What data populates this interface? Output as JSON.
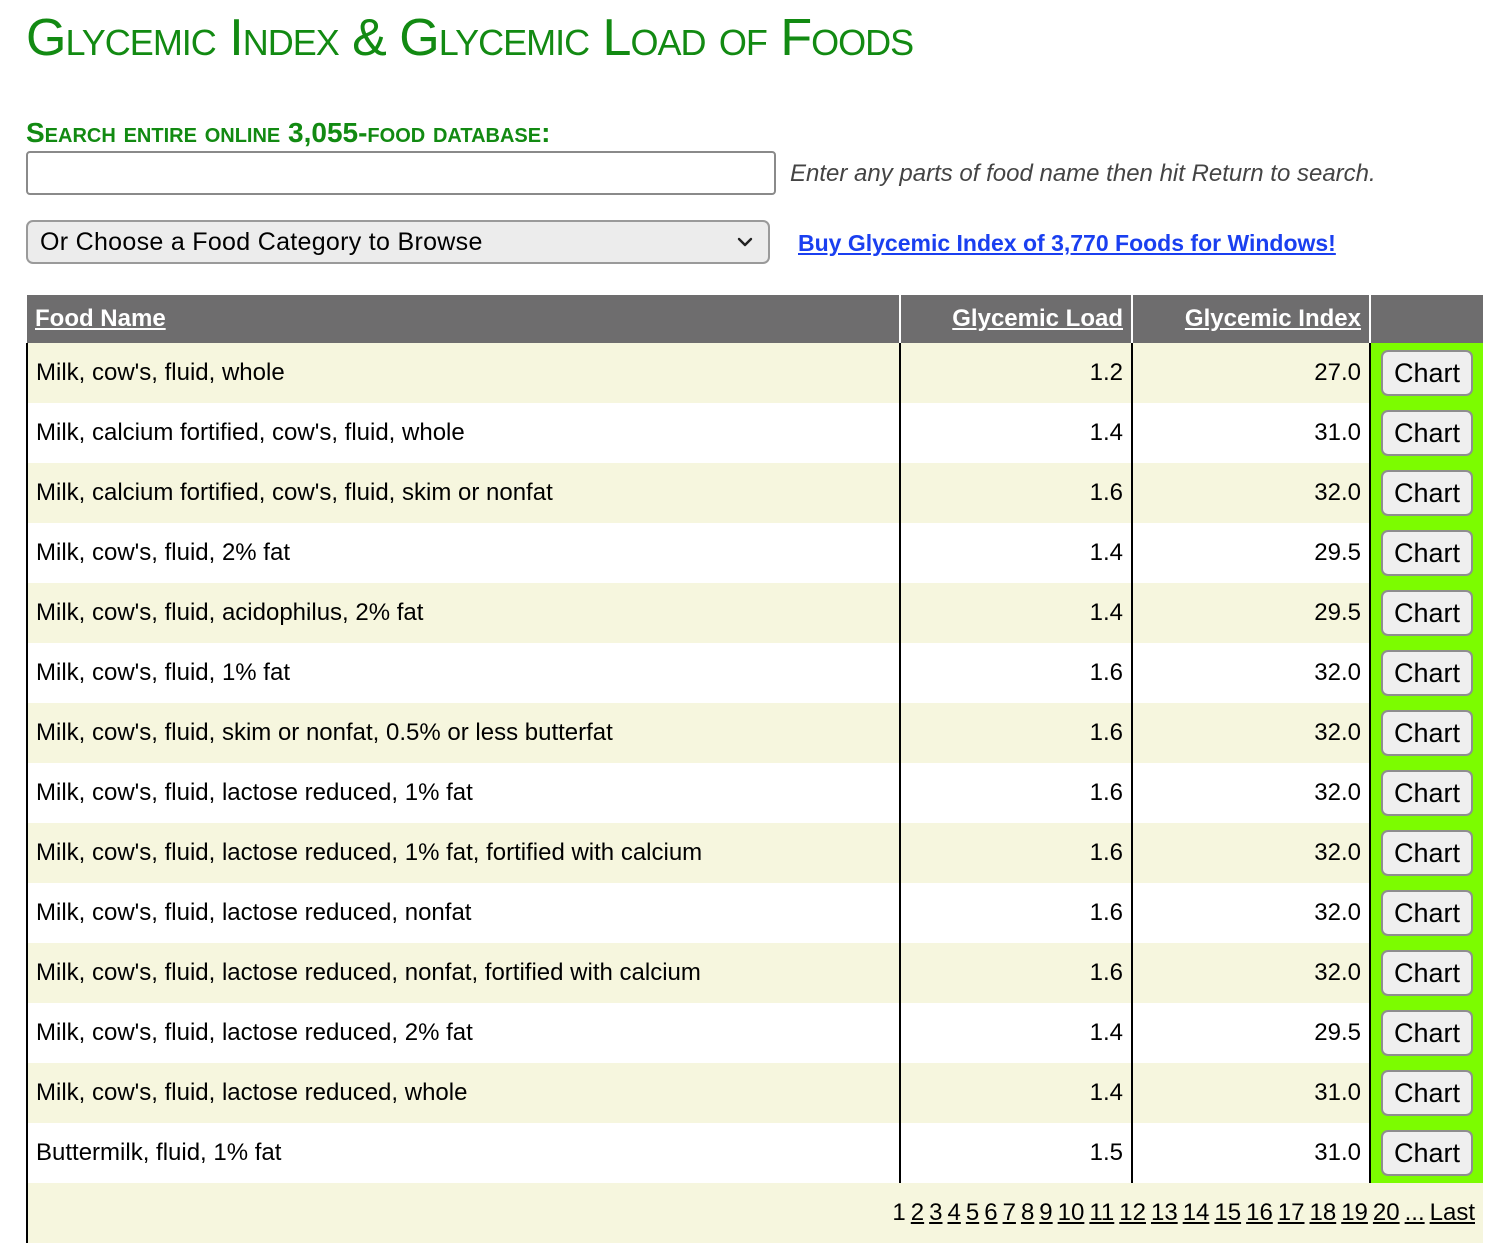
{
  "title": "Glycemic Index & Glycemic Load of Foods",
  "search": {
    "label": "Search entire online 3,055-food database:",
    "value": "",
    "placeholder": "",
    "hint": "Enter any parts of food name then hit Return to search."
  },
  "category": {
    "selected": "Or Choose a Food Category to Browse"
  },
  "buy_link": "Buy Glycemic Index of 3,770 Foods for Windows!",
  "table": {
    "headers": {
      "name": "Food Name",
      "load": "Glycemic Load",
      "index": "Glycemic Index"
    },
    "chart_label": "Chart",
    "rows": [
      {
        "name": "Milk, cow's, fluid, whole",
        "load": "1.2",
        "index": "27.0"
      },
      {
        "name": "Milk, calcium fortified, cow's, fluid, whole",
        "load": "1.4",
        "index": "31.0"
      },
      {
        "name": "Milk, calcium fortified, cow's, fluid, skim or nonfat",
        "load": "1.6",
        "index": "32.0"
      },
      {
        "name": "Milk, cow's, fluid, 2% fat",
        "load": "1.4",
        "index": "29.5"
      },
      {
        "name": "Milk, cow's, fluid, acidophilus, 2% fat",
        "load": "1.4",
        "index": "29.5"
      },
      {
        "name": "Milk, cow's, fluid, 1% fat",
        "load": "1.6",
        "index": "32.0"
      },
      {
        "name": "Milk, cow's, fluid, skim or nonfat, 0.5% or less butterfat",
        "load": "1.6",
        "index": "32.0"
      },
      {
        "name": "Milk, cow's, fluid, lactose reduced, 1% fat",
        "load": "1.6",
        "index": "32.0"
      },
      {
        "name": "Milk, cow's, fluid, lactose reduced, 1% fat, fortified with calcium",
        "load": "1.6",
        "index": "32.0"
      },
      {
        "name": "Milk, cow's, fluid, lactose reduced, nonfat",
        "load": "1.6",
        "index": "32.0"
      },
      {
        "name": "Milk, cow's, fluid, lactose reduced, nonfat, fortified with calcium",
        "load": "1.6",
        "index": "32.0"
      },
      {
        "name": "Milk, cow's, fluid, lactose reduced, 2% fat",
        "load": "1.4",
        "index": "29.5"
      },
      {
        "name": "Milk, cow's, fluid, lactose reduced, whole",
        "load": "1.4",
        "index": "31.0"
      },
      {
        "name": "Buttermilk, fluid, 1% fat",
        "load": "1.5",
        "index": "31.0"
      }
    ]
  },
  "pagination": {
    "current": "1",
    "pages": [
      "2",
      "3",
      "4",
      "5",
      "6",
      "7",
      "8",
      "9",
      "10",
      "11",
      "12",
      "13",
      "14",
      "15",
      "16",
      "17",
      "18",
      "19",
      "20"
    ],
    "ellipsis": "...",
    "last": "Last"
  }
}
